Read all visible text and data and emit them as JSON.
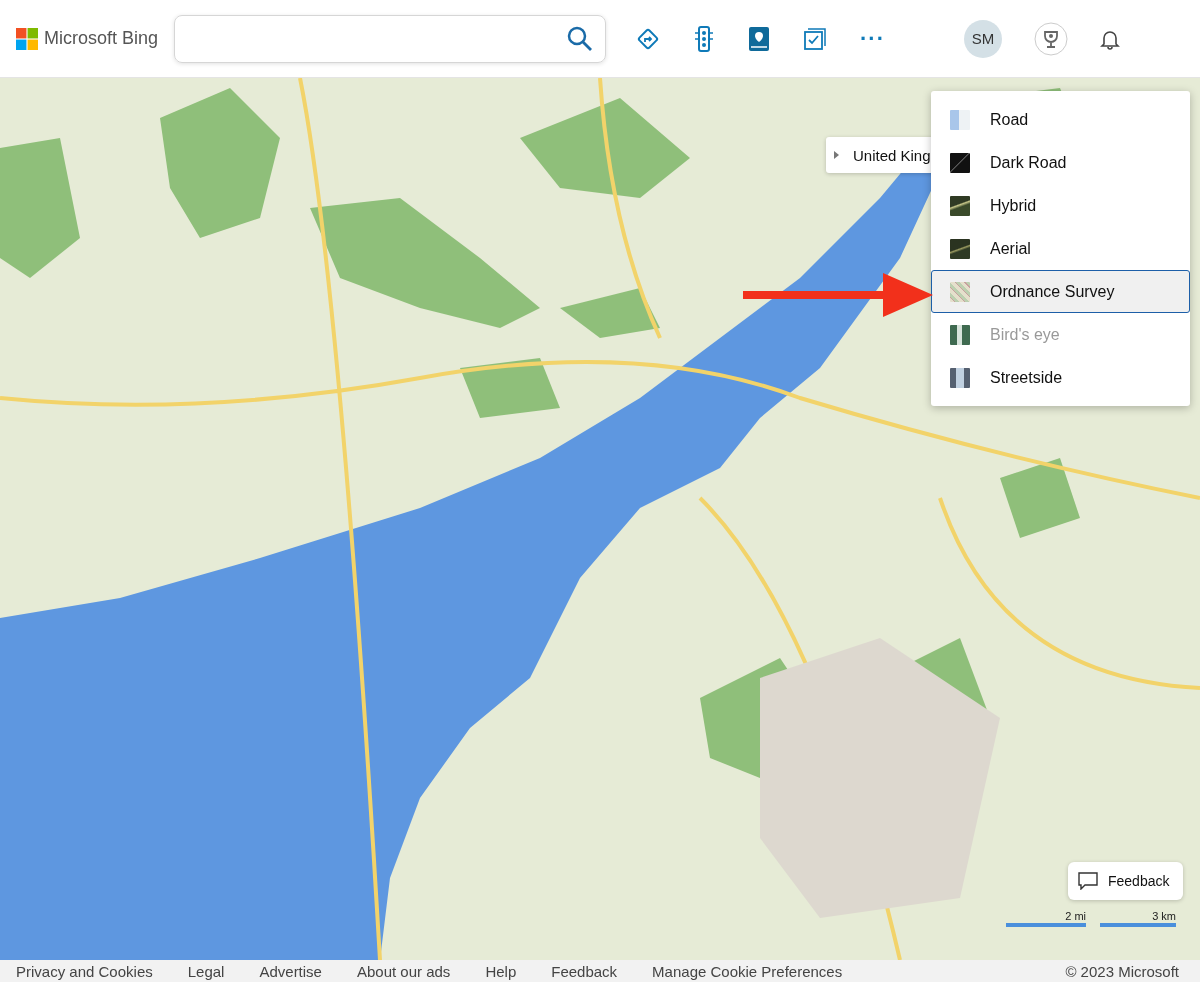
{
  "header": {
    "logo": "Microsoft Bing",
    "avatar": "SM",
    "more": "···"
  },
  "map": {
    "breadcrumb": "United King",
    "feedback": "Feedback",
    "scale": [
      "2 mi",
      "3 km"
    ],
    "styles": [
      {
        "label": "Road",
        "kind": "road",
        "selected": false,
        "disabled": false
      },
      {
        "label": "Dark Road",
        "kind": "darkroad",
        "selected": false,
        "disabled": false
      },
      {
        "label": "Hybrid",
        "kind": "hybrid",
        "selected": false,
        "disabled": false
      },
      {
        "label": "Aerial",
        "kind": "aerial",
        "selected": false,
        "disabled": false
      },
      {
        "label": "Ordnance Survey",
        "kind": "ordnance",
        "selected": true,
        "disabled": false
      },
      {
        "label": "Bird's eye",
        "kind": "birdseye",
        "selected": false,
        "disabled": true
      },
      {
        "label": "Streetside",
        "kind": "streetside",
        "selected": false,
        "disabled": false
      }
    ]
  },
  "footer": {
    "links": [
      "Privacy and Cookies",
      "Legal",
      "Advertise",
      "About our ads",
      "Help",
      "Feedback",
      "Manage Cookie Preferences"
    ],
    "copyright": "© 2023 Microsoft"
  }
}
